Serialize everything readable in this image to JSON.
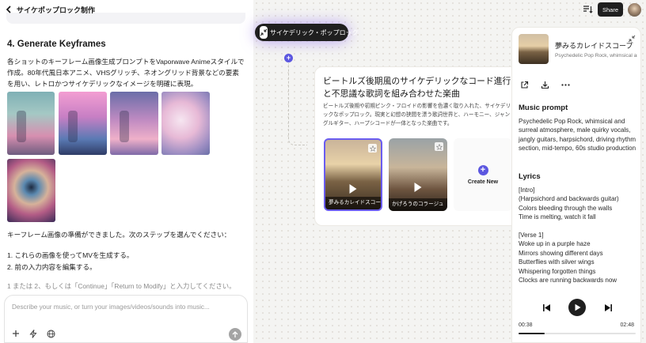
{
  "header": {
    "project_title": "サイケポップロック制作"
  },
  "chat": {
    "section_heading": "4. Generate Keyframes",
    "intro_text": "各ショットのキーフレーム画像生成プロンプトをVaporwave Animeスタイルで作成。80年代風日本アニメ、VHSグリッチ、ネオングリッド背景などの要素を用い、レトロかつサイケデリックなイメージを明確に表現。",
    "keyframe_images": [
      "keyframe-1",
      "keyframe-2",
      "keyframe-3",
      "keyframe-4",
      "keyframe-5"
    ],
    "ready_text": "キーフレーム画像の準備ができました。次のステップを選んでください：",
    "options": [
      "1. これらの画像を使ってMVを生成する。",
      "2. 前の入力内容を編集する。"
    ],
    "hint_text": "1 または 2、もしくは「Continue」「Return to Modify」と入力してください。",
    "composer": {
      "placeholder": "Describe your music, or turn your images/videos/sounds into music..."
    }
  },
  "canvas": {
    "node_label": "サイケデリック・ポップロック",
    "main_card": {
      "title": "ビートルズ後期風のサイケデリックなコード進行と不思議な歌詞を組み合わせた楽曲",
      "description": "ビートルズ後期や初期ピンク・フロイドの影響を色濃く取り入れた、サイケデリックなポップロック。現実と幻想の狭間を漂う歌詞世界と、ハーモニー、ジャングルギター、ハープシコードが一体となった楽曲です。",
      "songs": [
        {
          "title": "夢みるカレイドスコープ"
        },
        {
          "title": "かげろうのコラージュ"
        }
      ],
      "create_new_label": "Create New"
    }
  },
  "topbar": {
    "share_label": "Share"
  },
  "player": {
    "title": "夢みるカレイドスコープ",
    "subtitle": "Psychedelic Pop Rock, whimsical and surreal",
    "music_prompt_heading": "Music prompt",
    "music_prompt": "Psychedelic Pop Rock, whimsical and surreal atmosphere, male quirky vocals, jangly guitars, harpsichord, driving rhythm section, mid-tempo, 60s studio production",
    "lyrics_heading": "Lyrics",
    "lyrics": [
      "[Intro]",
      "(Harpsichord and backwards guitar)",
      "Colors bleeding through the walls",
      "Time is melting, watch it fall",
      "",
      "[Verse 1]",
      "Woke up in a purple haze",
      "Mirrors showing different days",
      "Butterflies with silver wings",
      "Whispering forgotten things",
      "Clocks are running backwards now"
    ],
    "time_current": "00:38",
    "time_total": "02:48",
    "progress": 0.22
  },
  "colors": {
    "accent": "#5c57e0",
    "dark": "#1f1f1f"
  }
}
